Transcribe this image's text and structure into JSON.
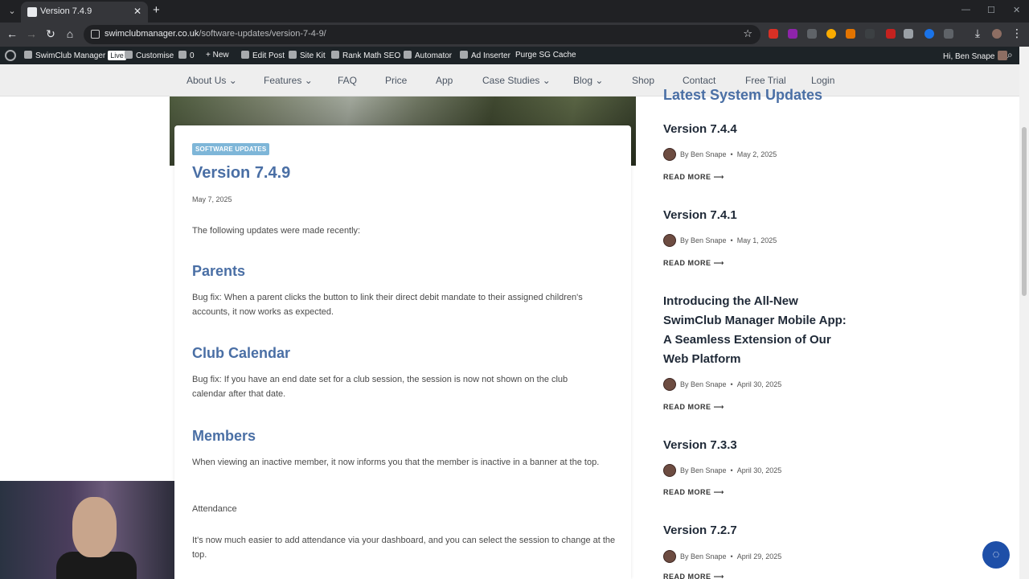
{
  "browser": {
    "tab_title": "Version 7.4.9",
    "tab_close": "✕",
    "new_tab": "+",
    "url_host": "swimclubmanager.co.uk",
    "url_path": "/software-updates/version-7-4-9/"
  },
  "admin_bar": {
    "site_name": "SwimClub Manager",
    "live_badge": "Live",
    "customise": "Customise",
    "comments_count": "0",
    "new": "New",
    "edit_post": "Edit Post",
    "site_kit": "Site Kit",
    "rank_math": "Rank Math SEO",
    "automator": "Automator",
    "ad_inserter": "Ad Inserter",
    "purge_cache": "Purge SG Cache",
    "greeting": "Hi, Ben Snape"
  },
  "site_nav": {
    "items": [
      "About Us ⌄",
      "Features ⌄",
      "FAQ",
      "Price",
      "App",
      "Case Studies ⌄",
      "Blog ⌄",
      "Shop",
      "Contact",
      "Free Trial",
      "Login"
    ]
  },
  "post": {
    "category": "SOFTWARE UPDATES",
    "title": "Version 7.4.9",
    "date": "May 7, 2025",
    "intro": "The following updates were made recently:",
    "sections": [
      {
        "heading": "Parents",
        "text": "Bug fix: When a parent clicks the button to link their direct debit mandate to their assigned children's accounts, it now works as expected."
      },
      {
        "heading": "Club Calendar",
        "text": "Bug fix: If you have an end date set for a club session, the session is now not shown on the club calendar after that date."
      },
      {
        "heading": "Members",
        "text": "When viewing an inactive member, it now informs you that the member is inactive in a banner at the top."
      }
    ],
    "attendance_label": "Attendance",
    "attendance_text": "It's now much easier to add attendance via your dashboard, and you can select the session to change at the top."
  },
  "sidebar": {
    "heading": "Latest System Updates",
    "posts": [
      {
        "title": "Version 7.4.4",
        "author": "By Ben Snape",
        "date": "May 2, 2025",
        "read_more": "READ MORE ⟶"
      },
      {
        "title": "Version 7.4.1",
        "author": "By Ben Snape",
        "date": "May 1, 2025",
        "read_more": "READ MORE ⟶"
      },
      {
        "title": "Introducing the All-New SwimClub Manager Mobile App: A Seamless Extension of Our Web Platform",
        "author": "By Ben Snape",
        "date": "April 30, 2025",
        "read_more": "READ MORE ⟶"
      },
      {
        "title": "Version 7.3.3",
        "author": "By Ben Snape",
        "date": "April 30, 2025",
        "read_more": "READ MORE ⟶"
      },
      {
        "title": "Version 7.2.7",
        "author": "By Ben Snape",
        "date": "April 29, 2025",
        "read_more": "READ MORE ⟶"
      }
    ]
  },
  "colors": {
    "accent": "#4a6fa5",
    "badge": "#7eb6d8",
    "chat": "#1e4fa8"
  }
}
